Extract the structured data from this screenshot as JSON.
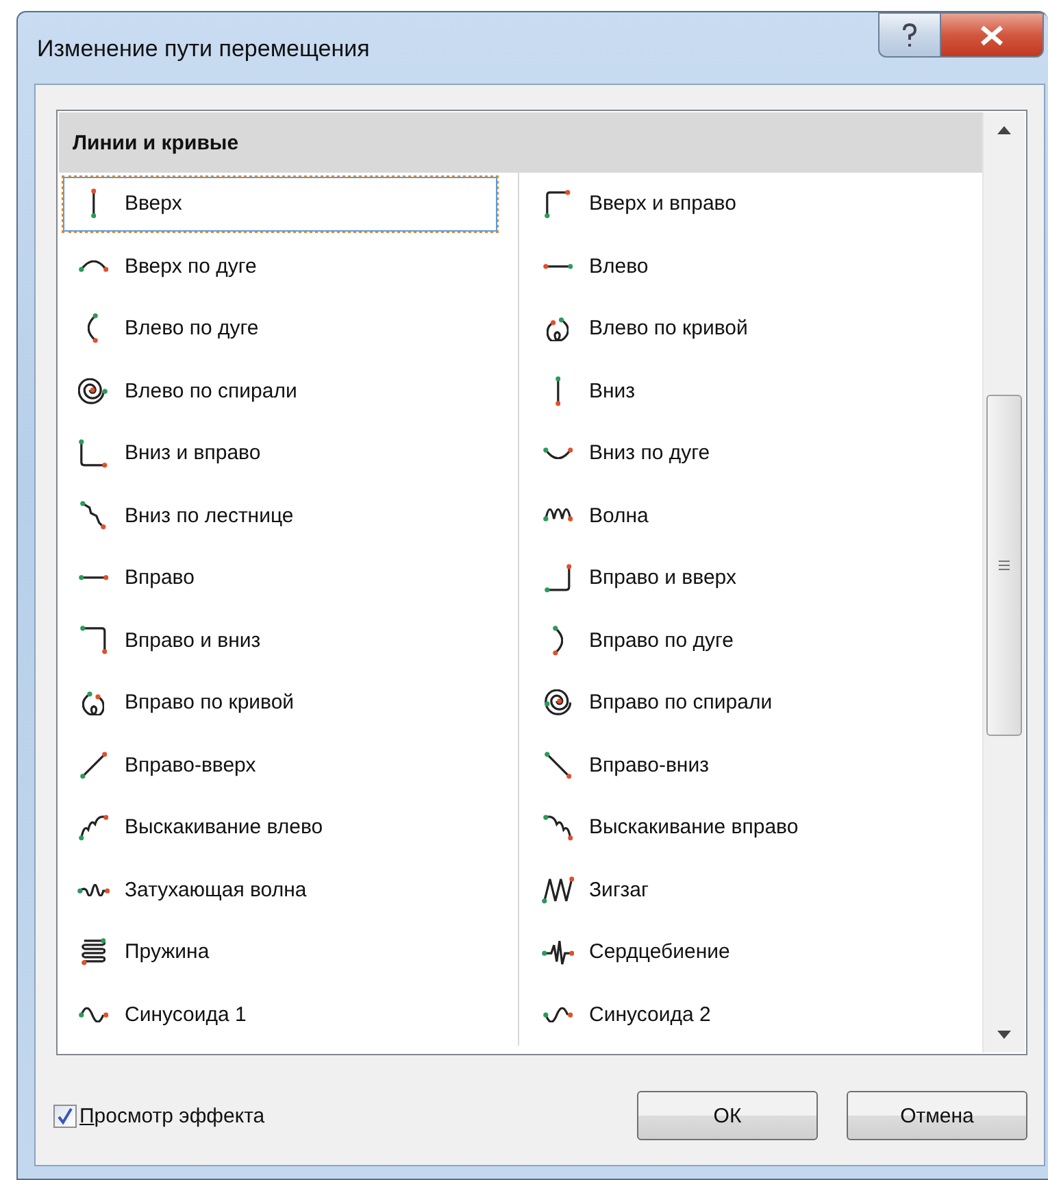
{
  "window": {
    "title": "Изменение пути перемещения"
  },
  "list": {
    "heading": "Линии и кривые",
    "items": [
      {
        "label": "Вверх",
        "selected": true
      },
      {
        "label": "Вверх и вправо",
        "selected": false
      },
      {
        "label": "Вверх по дуге",
        "selected": false
      },
      {
        "label": "Влево",
        "selected": false
      },
      {
        "label": "Влево по дуге",
        "selected": false
      },
      {
        "label": "Влево по кривой",
        "selected": false
      },
      {
        "label": "Влево по спирали",
        "selected": false
      },
      {
        "label": "Вниз",
        "selected": false
      },
      {
        "label": "Вниз и вправо",
        "selected": false
      },
      {
        "label": "Вниз по дуге",
        "selected": false
      },
      {
        "label": "Вниз по лестнице",
        "selected": false
      },
      {
        "label": "Волна",
        "selected": false
      },
      {
        "label": "Вправо",
        "selected": false
      },
      {
        "label": "Вправо и вверх",
        "selected": false
      },
      {
        "label": "Вправо и вниз",
        "selected": false
      },
      {
        "label": "Вправо по дуге",
        "selected": false
      },
      {
        "label": "Вправо по кривой",
        "selected": false
      },
      {
        "label": "Вправо по спирали",
        "selected": false
      },
      {
        "label": "Вправо-вверх",
        "selected": false
      },
      {
        "label": "Вправо-вниз",
        "selected": false
      },
      {
        "label": "Выскакивание влево",
        "selected": false
      },
      {
        "label": "Выскакивание вправо",
        "selected": false
      },
      {
        "label": "Затухающая волна",
        "selected": false
      },
      {
        "label": "Зигзаг",
        "selected": false
      },
      {
        "label": "Пружина",
        "selected": false
      },
      {
        "label": "Сердцебиение",
        "selected": false
      },
      {
        "label": "Синусоида 1",
        "selected": false
      },
      {
        "label": "Синусоида 2",
        "selected": false
      }
    ]
  },
  "preview": {
    "label": "Просмотр эффекта",
    "checked": true
  },
  "buttons": [
    "ОК",
    "Отмена"
  ]
}
